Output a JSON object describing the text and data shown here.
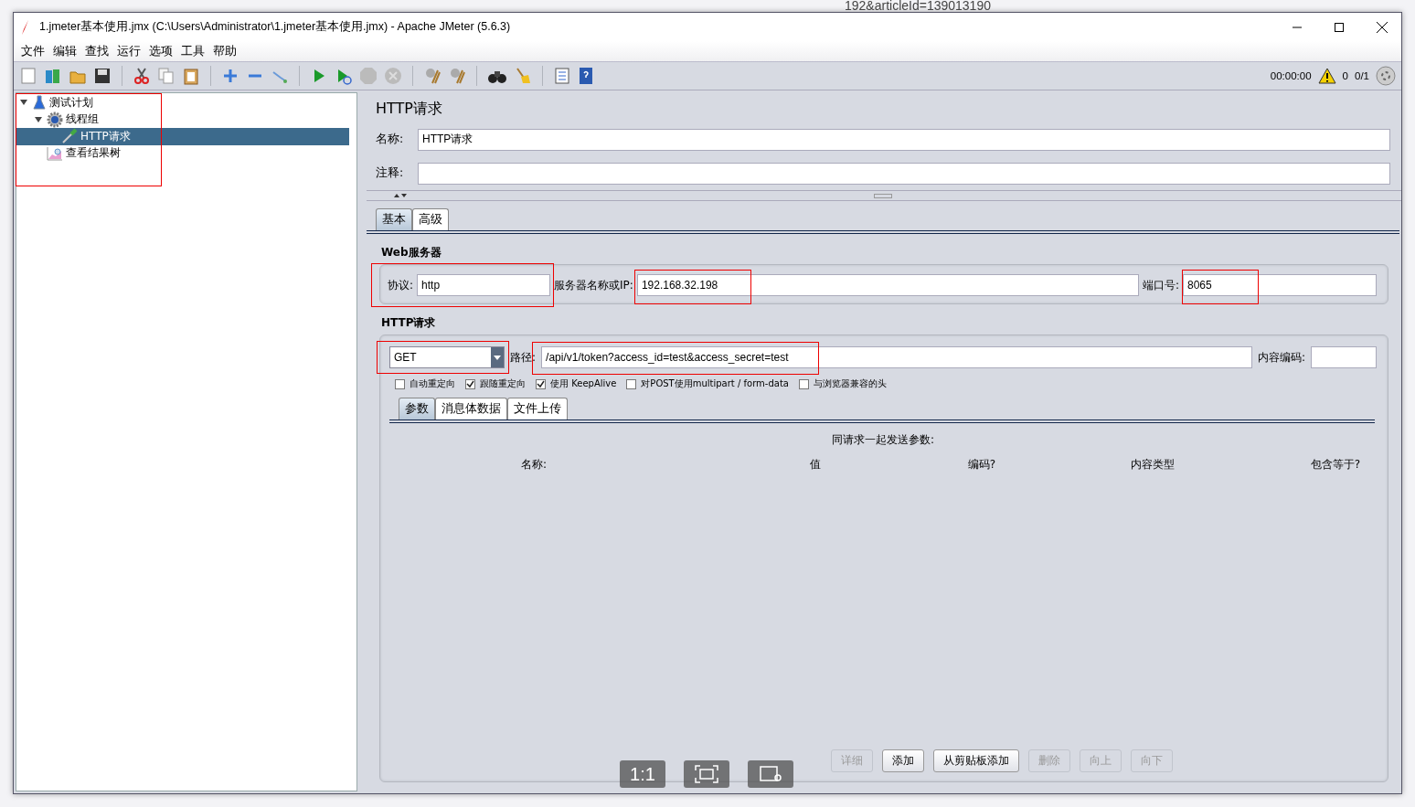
{
  "background_page": {
    "address_fragment": "192&articleId=139013190"
  },
  "window": {
    "title": "1.jmeter基本使用.jmx (C:\\Users\\Administrator\\1.jmeter基本使用.jmx) - Apache JMeter (5.6.3)"
  },
  "menu": [
    "文件",
    "编辑",
    "查找",
    "运行",
    "选项",
    "工具",
    "帮助"
  ],
  "status": {
    "elapsed": "00:00:00",
    "warnings": "0",
    "threads": "0/1"
  },
  "tree": {
    "highlighted": true,
    "items": [
      {
        "label": "测试计划",
        "kind": "plan",
        "expanded": true,
        "selected": false,
        "children": [
          {
            "label": "线程组",
            "kind": "thread-group",
            "expanded": true,
            "selected": false,
            "children": [
              {
                "label": "HTTP请求",
                "kind": "sampler",
                "selected": true
              }
            ]
          },
          {
            "label": "查看结果树",
            "kind": "listener",
            "selected": false
          }
        ]
      }
    ]
  },
  "panel": {
    "heading": "HTTP请求",
    "name_label": "名称:",
    "name_value": "HTTP请求",
    "comment_label": "注释:"
  },
  "tabs": [
    {
      "label": "基本",
      "selected": true
    },
    {
      "label": "高级",
      "selected": false
    }
  ],
  "web_server": {
    "title": "Web服务器",
    "fields": [
      {
        "label": "协议:",
        "value": "http",
        "highlighted": true
      },
      {
        "label": "服务器名称或IP:",
        "value": "192.168.32.198",
        "highlighted": true
      },
      {
        "label": "端口号:",
        "value": "8065",
        "highlighted": true
      }
    ]
  },
  "http_request": {
    "title": "HTTP请求",
    "method": {
      "value": "GET",
      "highlighted": true
    },
    "path_label": "路径:",
    "path": {
      "value": "/api/v1/token?access_id=test&access_secret=test",
      "highlighted": true
    },
    "encoding_label": "内容编码:"
  },
  "options": [
    {
      "label": "自动重定向",
      "checked": false
    },
    {
      "label": "跟随重定向",
      "checked": true
    },
    {
      "label": "使用 KeepAlive",
      "checked": true
    },
    {
      "label": "对POST使用multipart / form-data",
      "checked": false
    },
    {
      "label": "与浏览器兼容的头",
      "checked": false
    }
  ],
  "sub_tabs": [
    {
      "label": "参数",
      "selected": true
    },
    {
      "label": "消息体数据",
      "selected": false
    },
    {
      "label": "文件上传",
      "selected": false
    }
  ],
  "params": {
    "caption": "同请求一起发送参数:",
    "columns": [
      "名称:",
      "值",
      "编码?",
      "内容类型",
      "包含等于?"
    ]
  },
  "buttons": [
    {
      "label": "详细",
      "disabled": true
    },
    {
      "label": "添加",
      "disabled": false
    },
    {
      "label": "从剪贴板添加",
      "disabled": false
    },
    {
      "label": "删除",
      "disabled": true
    },
    {
      "label": "向上",
      "disabled": true
    },
    {
      "label": "向下",
      "disabled": true
    }
  ],
  "viewer_controls": [
    {
      "kind": "text",
      "label": "1:1"
    },
    {
      "kind": "fit"
    },
    {
      "kind": "export"
    }
  ]
}
